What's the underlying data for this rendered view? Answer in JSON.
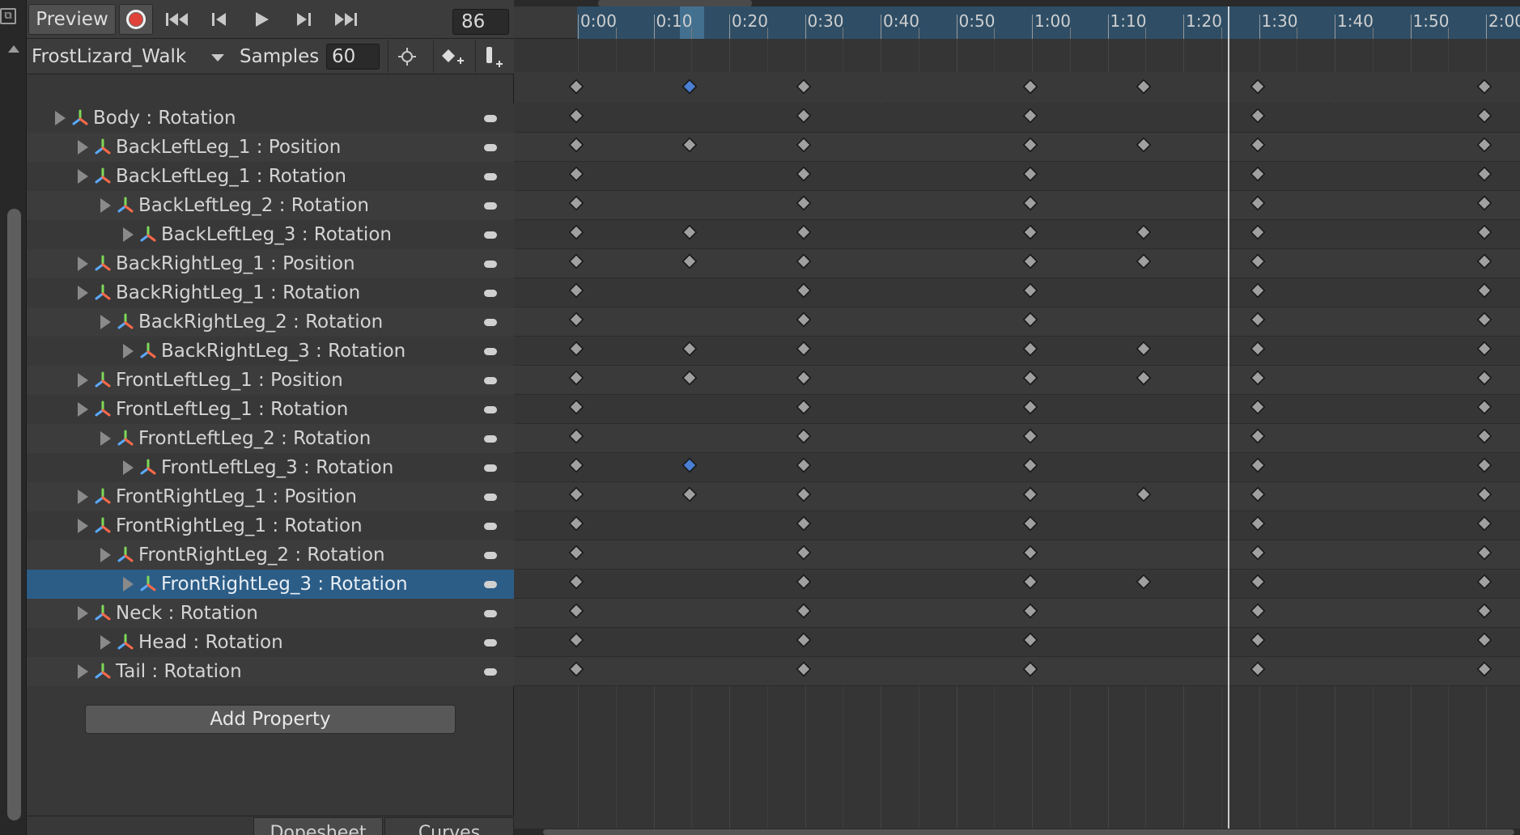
{
  "toolbar": {
    "preview_label": "Preview",
    "frame_value": "86"
  },
  "clip": {
    "name": "FrostLizard_Walk",
    "samples_label": "Samples",
    "samples_value": "60"
  },
  "properties": [
    {
      "label": "Body : Rotation",
      "indent": 0
    },
    {
      "label": "BackLeftLeg_1 : Position",
      "indent": 1
    },
    {
      "label": "BackLeftLeg_1 : Rotation",
      "indent": 1
    },
    {
      "label": "BackLeftLeg_2 : Rotation",
      "indent": 2
    },
    {
      "label": "BackLeftLeg_3 : Rotation",
      "indent": 3
    },
    {
      "label": "BackRightLeg_1 : Position",
      "indent": 1
    },
    {
      "label": "BackRightLeg_1 : Rotation",
      "indent": 1
    },
    {
      "label": "BackRightLeg_2 : Rotation",
      "indent": 2
    },
    {
      "label": "BackRightLeg_3 : Rotation",
      "indent": 3
    },
    {
      "label": "FrontLeftLeg_1 : Position",
      "indent": 1
    },
    {
      "label": "FrontLeftLeg_1 : Rotation",
      "indent": 1
    },
    {
      "label": "FrontLeftLeg_2 : Rotation",
      "indent": 2
    },
    {
      "label": "FrontLeftLeg_3 : Rotation",
      "indent": 3
    },
    {
      "label": "FrontRightLeg_1 : Position",
      "indent": 1
    },
    {
      "label": "FrontRightLeg_1 : Rotation",
      "indent": 1
    },
    {
      "label": "FrontRightLeg_2 : Rotation",
      "indent": 2
    },
    {
      "label": "FrontRightLeg_3 : Rotation",
      "indent": 3,
      "selected": true
    },
    {
      "label": "Neck : Rotation",
      "indent": 1
    },
    {
      "label": "Head : Rotation",
      "indent": 2
    },
    {
      "label": "Tail : Rotation",
      "indent": 1
    }
  ],
  "add_property_label": "Add Property",
  "tabs": {
    "dopesheet": "Dopesheet",
    "curves": "Curves"
  },
  "timeline": {
    "ticks": [
      "0:00",
      "0:10",
      "0:20",
      "0:30",
      "0:40",
      "0:50",
      "1:00",
      "1:10",
      "1:20",
      "1:30",
      "1:40",
      "1:50",
      "2:00"
    ],
    "playhead_frame": 86,
    "summary_keys": [
      0,
      15,
      30,
      60,
      75,
      90,
      120
    ],
    "summary_selected": [
      15
    ],
    "track_keys": [
      [
        0,
        30,
        60,
        90,
        120
      ],
      [
        0,
        15,
        30,
        60,
        75,
        90,
        120
      ],
      [
        0,
        30,
        60,
        90,
        120
      ],
      [
        0,
        30,
        60,
        90,
        120
      ],
      [
        0,
        15,
        30,
        60,
        75,
        90,
        120
      ],
      [
        0,
        15,
        30,
        60,
        75,
        90,
        120
      ],
      [
        0,
        30,
        60,
        90,
        120
      ],
      [
        0,
        30,
        60,
        90,
        120
      ],
      [
        0,
        15,
        30,
        60,
        75,
        90,
        120
      ],
      [
        0,
        15,
        30,
        60,
        75,
        90,
        120
      ],
      [
        0,
        30,
        60,
        90,
        120
      ],
      [
        0,
        30,
        60,
        90,
        120
      ],
      [
        0,
        15,
        30,
        60,
        90,
        120
      ],
      [
        0,
        15,
        30,
        60,
        75,
        90,
        120
      ],
      [
        0,
        30,
        60,
        90,
        120
      ],
      [
        0,
        30,
        60,
        90,
        120
      ],
      [
        0,
        30,
        60,
        75,
        90,
        120
      ],
      [
        0,
        30,
        60,
        90,
        120
      ],
      [
        0,
        30,
        60,
        90,
        120
      ],
      [
        0,
        30,
        60,
        90,
        120
      ]
    ],
    "selected_keys": [
      [
        12,
        15
      ]
    ]
  },
  "icons": {
    "record": "record-icon",
    "first_key": "first-keyframe-icon",
    "prev_key": "previous-keyframe-icon",
    "play": "play-icon",
    "next_key": "next-keyframe-icon",
    "last_key": "last-keyframe-icon",
    "snap": "crosshair-icon",
    "add_key": "add-keyframe-icon",
    "add_event": "add-event-icon"
  },
  "colors": {
    "selection": "#2c5d87",
    "selected_key": "#4a7fd4",
    "record": "#e0433a"
  }
}
